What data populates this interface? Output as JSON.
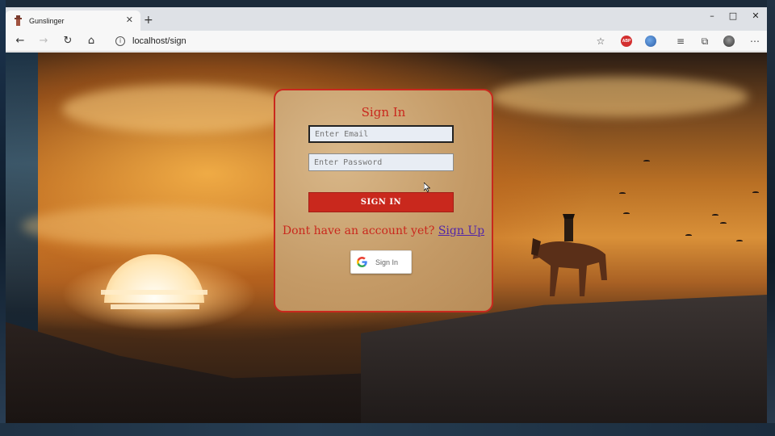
{
  "browser": {
    "tab_title": "Gunslinger",
    "url": "localhost/sign"
  },
  "signin": {
    "title": "Sign In",
    "email_placeholder": "Enter Email",
    "password_placeholder": "Enter Password",
    "submit_label": "SIGN IN",
    "signup_prompt": "Dont have an account yet?",
    "signup_link": "Sign Up",
    "google_label": "Sign In"
  },
  "icons": {
    "back": "back-arrow-icon",
    "forward": "forward-arrow-icon",
    "reload": "reload-icon",
    "home": "home-icon",
    "info": "site-info-icon",
    "favorite": "star-icon",
    "google": "google-g-icon"
  },
  "colors": {
    "accent": "#c9281d",
    "link": "#5226a8"
  }
}
